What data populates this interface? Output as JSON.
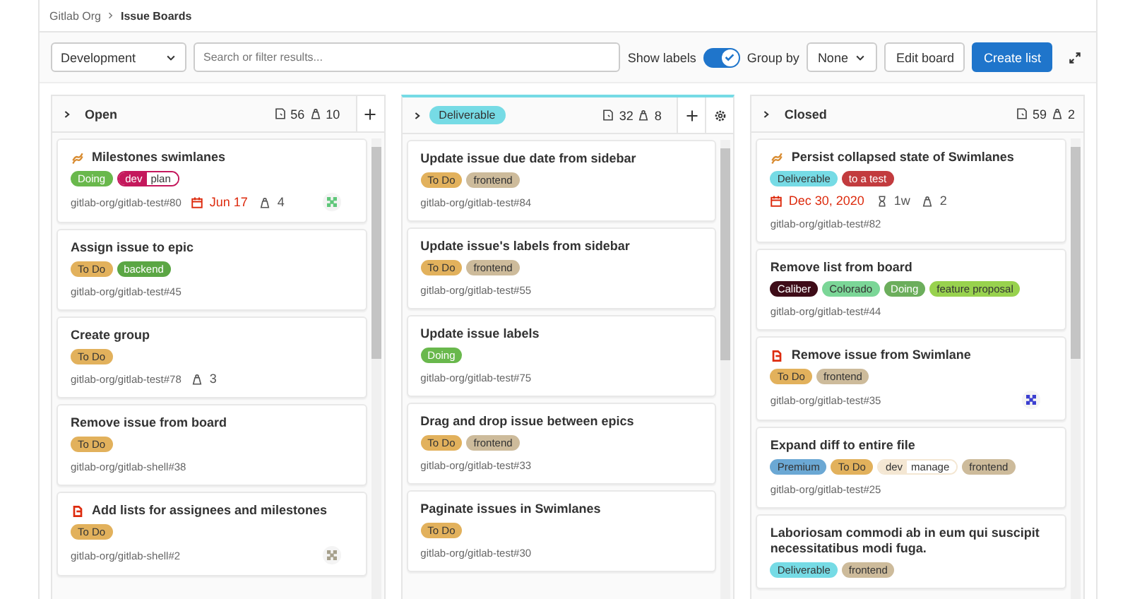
{
  "breadcrumb": [
    {
      "text": "Gitlab Org"
    },
    {
      "text": "Issue Boards"
    }
  ],
  "toolbar": {
    "board_select": "Development",
    "search": {
      "placeholder": "Search or filter results..."
    },
    "show_labels": {
      "label": "Show labels",
      "on": true
    },
    "group_by": {
      "label": "Group by",
      "value": "None"
    },
    "buttons": [
      {
        "label": "Edit board",
        "kind": "default"
      },
      {
        "label": "Create list",
        "kind": "primary"
      }
    ]
  },
  "columns": [
    {
      "title": "Open",
      "kind": "open",
      "issue_count": "56",
      "weight": "10",
      "cards": [
        {
          "kind": "epic",
          "title": "Milestones swimlanes",
          "labels": [
            {
              "text": "Doing",
              "color": "#69b84c"
            },
            {
              "scope": "dev",
              "text": "plan",
              "color": "#c4185c"
            }
          ],
          "meta": [
            [
              {
                "kind": "reference",
                "text": "gitlab-org/gitlab-test#80"
              },
              {
                "kind": "due",
                "text": "Jun 17"
              },
              {
                "kind": "weight",
                "text": "4"
              }
            ]
          ],
          "avatar": {
            "color": "#5fc77a"
          }
        },
        {
          "kind": "plain",
          "title": "Assign issue to epic",
          "labels": [
            {
              "text": "To Do",
              "color": "#e2b15c"
            },
            {
              "text": "backend",
              "color": "#5ba644"
            }
          ],
          "meta": [
            [
              {
                "kind": "reference",
                "text": "gitlab-org/gitlab-test#45"
              }
            ]
          ]
        },
        {
          "kind": "plain",
          "title": "Create group",
          "labels": [
            {
              "text": "To Do",
              "color": "#e2b15c"
            }
          ],
          "meta": [
            [
              {
                "kind": "reference",
                "text": "gitlab-org/gitlab-test#78"
              },
              {
                "kind": "weight",
                "text": "3"
              }
            ]
          ]
        },
        {
          "kind": "plain",
          "title": "Remove issue from board",
          "labels": [
            {
              "text": "To Do",
              "color": "#e2b15c"
            }
          ],
          "meta": [
            [
              {
                "kind": "reference",
                "text": "gitlab-org/gitlab-shell#38"
              }
            ]
          ]
        },
        {
          "kind": "blocked",
          "title": "Add lists for assignees and milestones",
          "labels": [
            {
              "text": "To Do",
              "color": "#e2b15c"
            }
          ],
          "meta": [
            [
              {
                "kind": "reference",
                "text": "gitlab-org/gitlab-shell#2"
              }
            ]
          ],
          "avatar": {
            "color": "#a6a08c"
          }
        }
      ]
    },
    {
      "title": "Deliverable",
      "kind": "label",
      "color": "#76dbe5",
      "issue_count": "32",
      "weight": "8",
      "cards": [
        {
          "kind": "plain",
          "title": "Update issue due date from sidebar",
          "labels": [
            {
              "text": "To Do",
              "color": "#e2b15c"
            },
            {
              "text": "frontend",
              "color": "#cdbb9b"
            }
          ],
          "meta": [
            [
              {
                "kind": "reference",
                "text": "gitlab-org/gitlab-test#84"
              }
            ]
          ]
        },
        {
          "kind": "plain",
          "title": "Update issue's labels from sidebar",
          "labels": [
            {
              "text": "To Do",
              "color": "#e2b15c"
            },
            {
              "text": "frontend",
              "color": "#cdbb9b"
            }
          ],
          "meta": [
            [
              {
                "kind": "reference",
                "text": "gitlab-org/gitlab-test#55"
              }
            ]
          ]
        },
        {
          "kind": "plain",
          "title": "Update issue labels",
          "labels": [
            {
              "text": "Doing",
              "color": "#69b84c"
            }
          ],
          "meta": [
            [
              {
                "kind": "reference",
                "text": "gitlab-org/gitlab-test#75"
              }
            ]
          ]
        },
        {
          "kind": "plain",
          "title": "Drag and drop issue between epics",
          "labels": [
            {
              "text": "To Do",
              "color": "#e2b15c"
            },
            {
              "text": "frontend",
              "color": "#cdbb9b"
            }
          ],
          "meta": [
            [
              {
                "kind": "reference",
                "text": "gitlab-org/gitlab-test#33"
              }
            ]
          ]
        },
        {
          "kind": "plain",
          "title": "Paginate issues in Swimlanes",
          "labels": [
            {
              "text": "To Do",
              "color": "#e2b15c"
            }
          ],
          "meta": [
            [
              {
                "kind": "reference",
                "text": "gitlab-org/gitlab-test#30"
              }
            ]
          ]
        }
      ]
    },
    {
      "title": "Closed",
      "kind": "closed",
      "issue_count": "59",
      "weight": "2",
      "cards": [
        {
          "kind": "epic",
          "title": "Persist collapsed state of Swimlanes",
          "labels": [
            {
              "text": "Deliverable",
              "color": "#76dbe5"
            },
            {
              "text": "to a test",
              "color": "#c23b3e"
            }
          ],
          "meta": [
            [
              {
                "kind": "due",
                "text": "Dec 30, 2020"
              },
              {
                "kind": "estimate",
                "text": "1w"
              },
              {
                "kind": "weight",
                "text": "2"
              }
            ],
            [
              {
                "kind": "reference",
                "text": "gitlab-org/gitlab-test#82"
              }
            ]
          ]
        },
        {
          "kind": "plain",
          "title": "Remove list from board",
          "labels": [
            {
              "text": "Caliber",
              "color": "#3e0c18"
            },
            {
              "text": "Colorado",
              "color": "#7bd697"
            },
            {
              "text": "Doing",
              "color": "#6cae5c"
            },
            {
              "text": "feature proposal",
              "color": "#98d24e"
            }
          ],
          "meta": [
            [
              {
                "kind": "reference",
                "text": "gitlab-org/gitlab-test#44"
              }
            ]
          ]
        },
        {
          "kind": "blocked",
          "title": "Remove issue from Swimlane",
          "labels": [
            {
              "text": "To Do",
              "color": "#e2b15c"
            },
            {
              "text": "frontend",
              "color": "#cdbb9b"
            }
          ],
          "meta": [
            [
              {
                "kind": "reference",
                "text": "gitlab-org/gitlab-test#35"
              }
            ]
          ],
          "avatar": {
            "color": "#3b3fd0"
          }
        },
        {
          "kind": "plain",
          "title": "Expand diff to entire file",
          "labels": [
            {
              "text": "Premium",
              "color": "#6ba8d4"
            },
            {
              "text": "To Do",
              "color": "#e2b15c"
            },
            {
              "scope": "dev",
              "text": "manage",
              "color": "#f4e7d3"
            },
            {
              "text": "frontend",
              "color": "#cdbb9b"
            }
          ],
          "meta": [
            [
              {
                "kind": "reference",
                "text": "gitlab-org/gitlab-test#25"
              }
            ]
          ]
        },
        {
          "kind": "plain",
          "title": "Laboriosam commodi ab in eum qui suscipit necessitatibus modi fuga.",
          "labels": [
            {
              "text": "Deliverable",
              "color": "#76dbe5"
            },
            {
              "text": "frontend",
              "color": "#cdbb9b"
            }
          ]
        }
      ]
    }
  ]
}
